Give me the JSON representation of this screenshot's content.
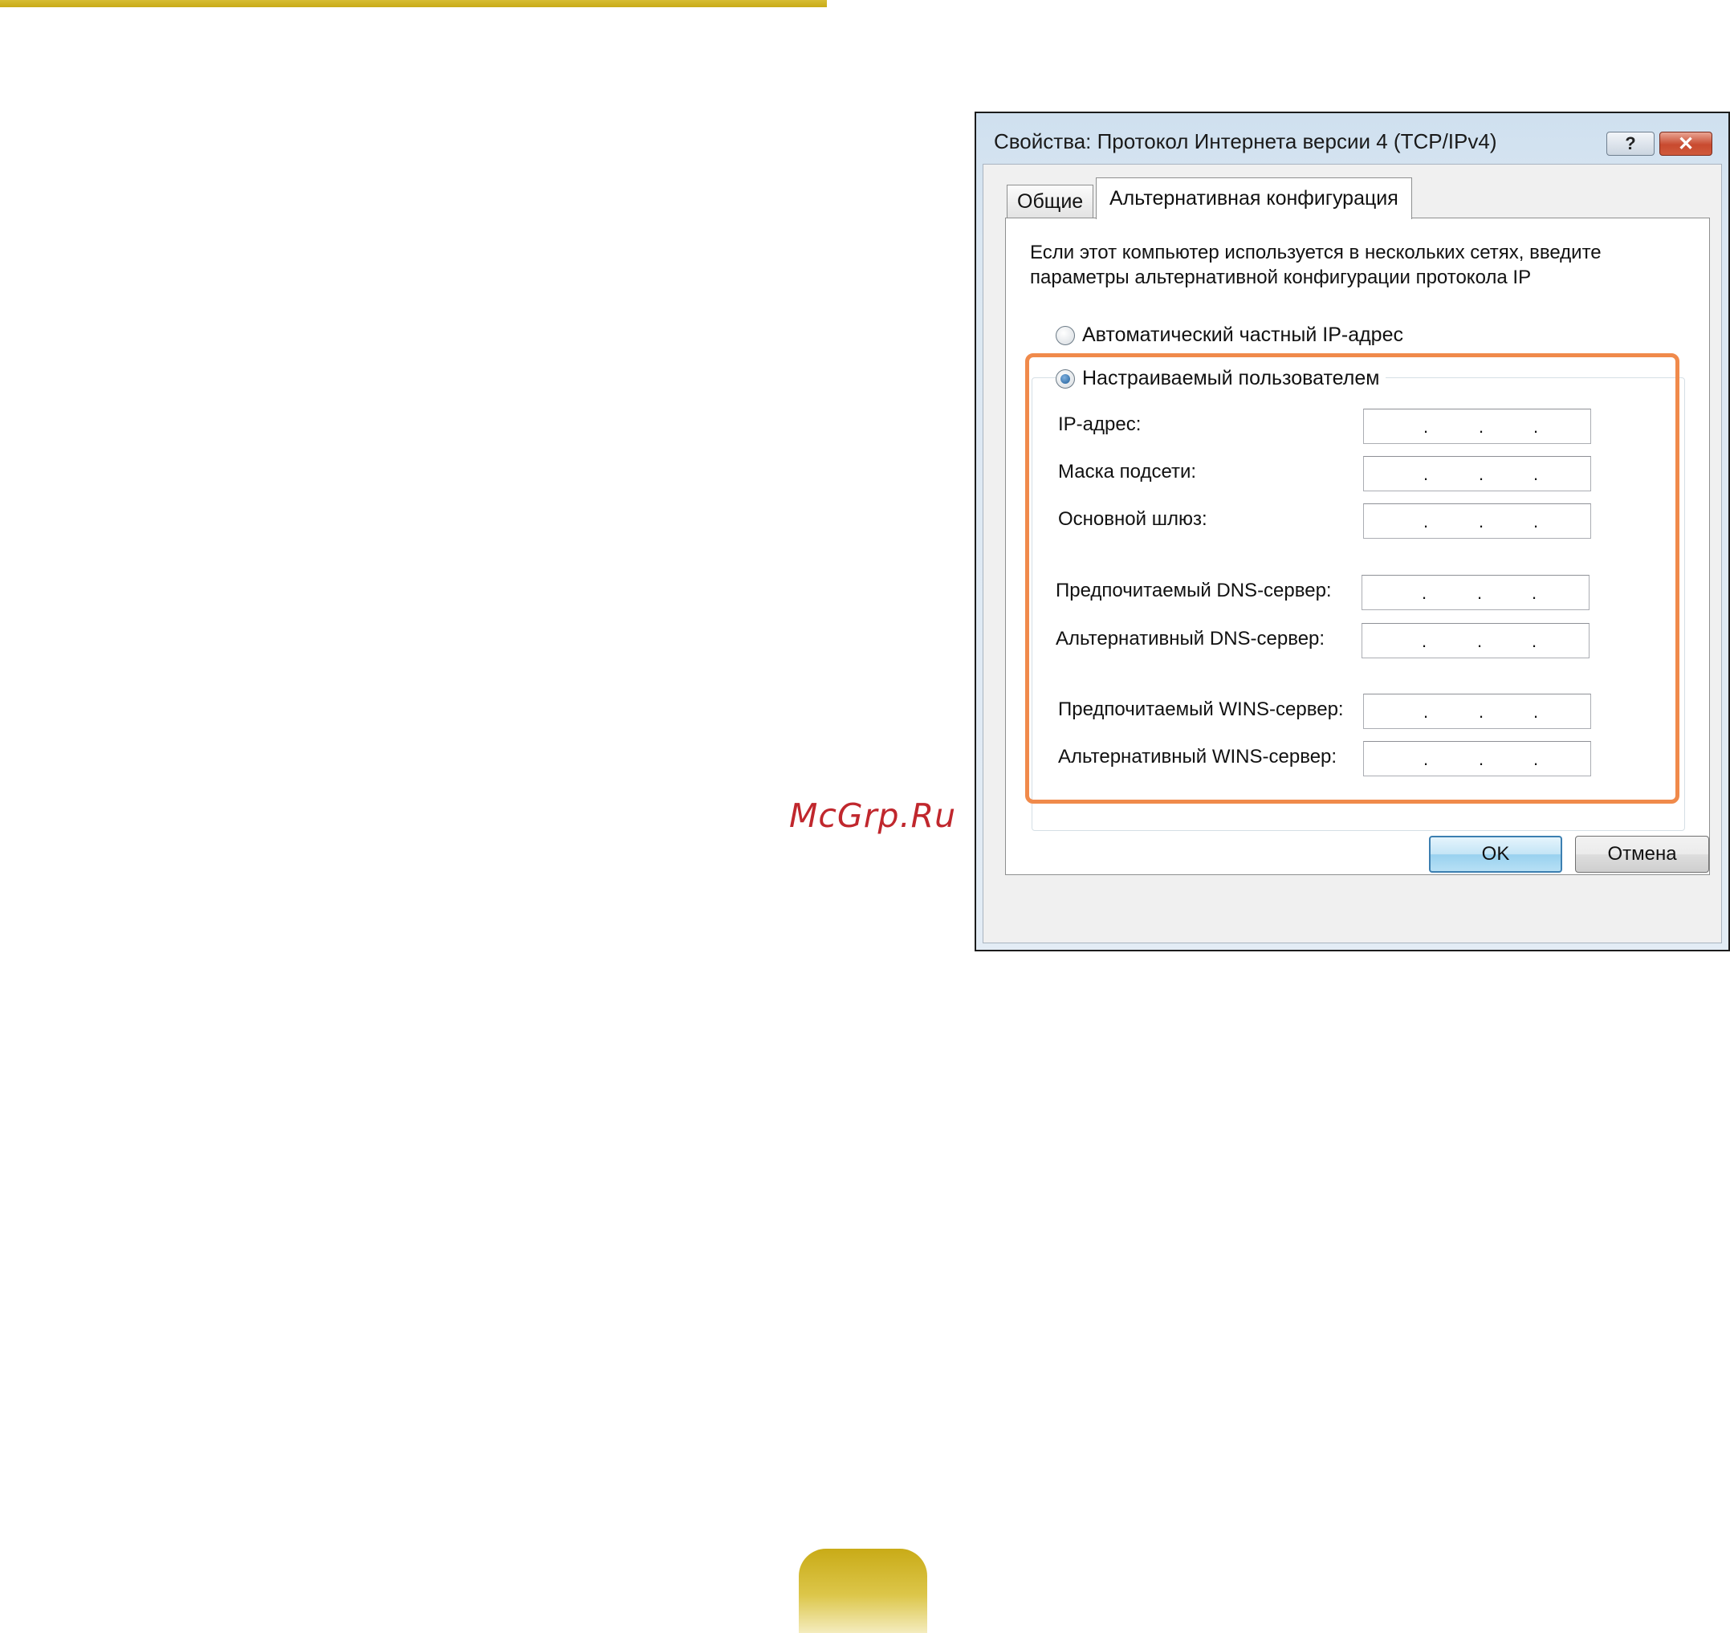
{
  "page": {
    "watermark": "McGrp.Ru",
    "accent_color": "#c9ab17",
    "highlight_color": "#f08a4b"
  },
  "dialog": {
    "title": "Свойства: Протокол Интернета версии 4 (TCP/IPv4)",
    "help_label": "?",
    "close_label": "✕",
    "tabs": [
      {
        "label": "Общие",
        "selected": false
      },
      {
        "label": "Альтернативная конфигурация",
        "selected": true
      }
    ],
    "intro_text": "Если этот компьютер используется в нескольких сетях, введите параметры альтернативной конфигурации протокола IP",
    "radio_auto": {
      "label": "Автоматический частный IP-адрес",
      "selected": false
    },
    "radio_user": {
      "label": "Настраиваемый пользователем",
      "selected": true
    },
    "fields": [
      {
        "label": "IP-адрес:",
        "value": ". . ."
      },
      {
        "label": "Маска подсети:",
        "value": ". . ."
      },
      {
        "label": "Основной шлюз:",
        "value": ". . ."
      },
      {
        "label": "Предпочитаемый DNS-сервер:",
        "value": ". . ."
      },
      {
        "label": "Альтернативный DNS-сервер:",
        "value": ". . ."
      },
      {
        "label": "Предпочитаемый WINS-сервер:",
        "value": ". . ."
      },
      {
        "label": "Альтернативный WINS-сервер:",
        "value": ". . ."
      }
    ],
    "ok_label": "OK",
    "cancel_label": "Отмена"
  }
}
